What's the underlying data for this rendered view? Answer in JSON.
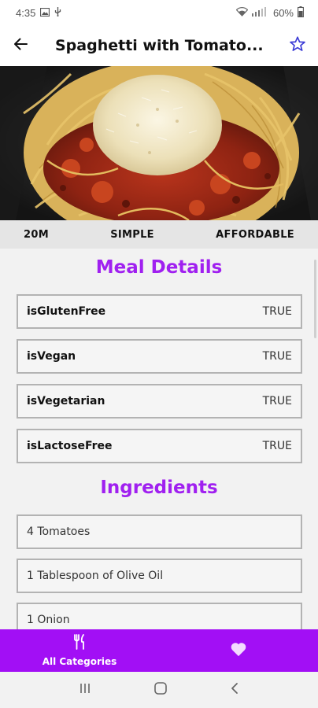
{
  "status_bar": {
    "time": "4:35",
    "battery": "60%",
    "icons": [
      "image-icon",
      "usb-icon",
      "wifi-icon",
      "signal-icon",
      "battery-icon"
    ]
  },
  "app_bar": {
    "title": "Spaghetti with Tomato...",
    "back_icon": "arrow-left-icon",
    "favorite_icon": "star-outline-icon"
  },
  "hero": {
    "image_subject": "spaghetti with tomato sauce and grated cheese"
  },
  "info": {
    "duration": "20M",
    "complexity": "SIMPLE",
    "affordability": "AFFORDABLE"
  },
  "meal_details": {
    "title": "Meal Details",
    "items": [
      {
        "key": "isGlutenFree",
        "value": "TRUE"
      },
      {
        "key": "isVegan",
        "value": "TRUE"
      },
      {
        "key": "isVegetarian",
        "value": "TRUE"
      },
      {
        "key": "isLactoseFree",
        "value": "TRUE"
      }
    ]
  },
  "ingredients": {
    "title": "Ingredients",
    "items": [
      "4 Tomatoes",
      "1 Tablespoon of Olive Oil",
      "1 Onion"
    ]
  },
  "bottom_nav": {
    "items": [
      {
        "label": "All Categories",
        "icon": "cutlery-icon"
      },
      {
        "label": "",
        "icon": "heart-icon"
      }
    ]
  },
  "colors": {
    "accent": "#a020f0",
    "nav_background": "#a20ff5",
    "info_bar": "#e5e5e5"
  }
}
